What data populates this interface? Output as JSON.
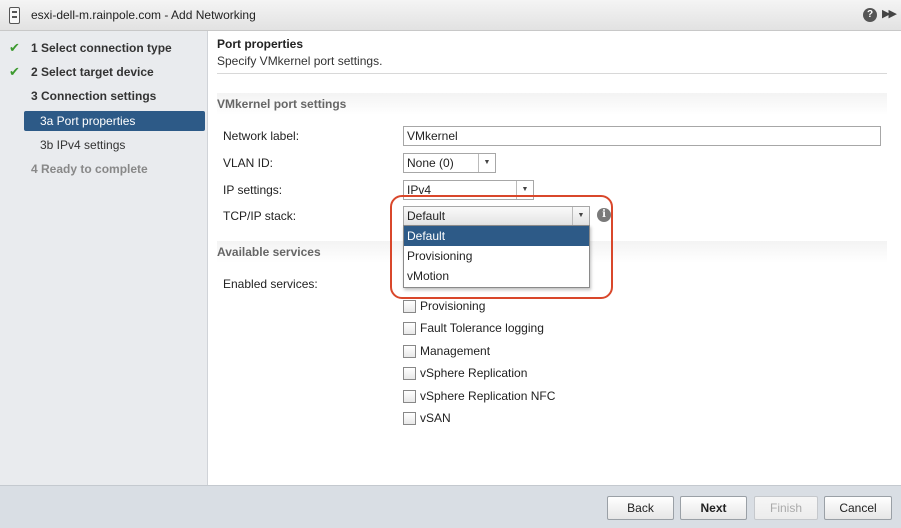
{
  "window": {
    "title": "esxi-dell-m.rainpole.com - Add Networking",
    "help_icon": "?",
    "more_icon": "▶▶"
  },
  "steps": [
    {
      "label": "1  Select connection type",
      "state": "done",
      "check": "✔"
    },
    {
      "label": "2  Select target device",
      "state": "done",
      "check": "✔"
    },
    {
      "label": "3  Connection settings",
      "state": "current"
    },
    {
      "label": "3a  Port properties",
      "state": "active-sub"
    },
    {
      "label": "3b  IPv4 settings",
      "state": "sub"
    },
    {
      "label": "4  Ready to complete",
      "state": "future"
    }
  ],
  "page": {
    "title": "Port properties",
    "subtitle": "Specify VMkernel port settings."
  },
  "vmkernel_section": {
    "title": "VMkernel port settings",
    "network_label": {
      "label": "Network label:",
      "value": "VMkernel"
    },
    "vlan_id": {
      "label": "VLAN ID:",
      "value": "None (0)"
    },
    "ip_settings": {
      "label": "IP settings:",
      "value": "IPv4"
    },
    "tcpip_stack": {
      "label": "TCP/IP stack:",
      "value": "Default",
      "options": [
        "Default",
        "Provisioning",
        "vMotion"
      ],
      "selected_index": 0
    },
    "info_icon": "i"
  },
  "services_section": {
    "title": "Available services",
    "enabled_label": "Enabled services:",
    "services": [
      {
        "label": "Provisioning",
        "checked": false
      },
      {
        "label": "Fault Tolerance logging",
        "checked": false
      },
      {
        "label": "Management",
        "checked": false
      },
      {
        "label": "vSphere Replication",
        "checked": false
      },
      {
        "label": "vSphere Replication NFC",
        "checked": false
      },
      {
        "label": "vSAN",
        "checked": false
      }
    ]
  },
  "footer": {
    "back": "Back",
    "next": "Next",
    "finish": "Finish",
    "cancel": "Cancel"
  },
  "colors": {
    "active_step": "#2d5a87",
    "check": "#3c9a2e",
    "highlight": "#d9472b"
  }
}
